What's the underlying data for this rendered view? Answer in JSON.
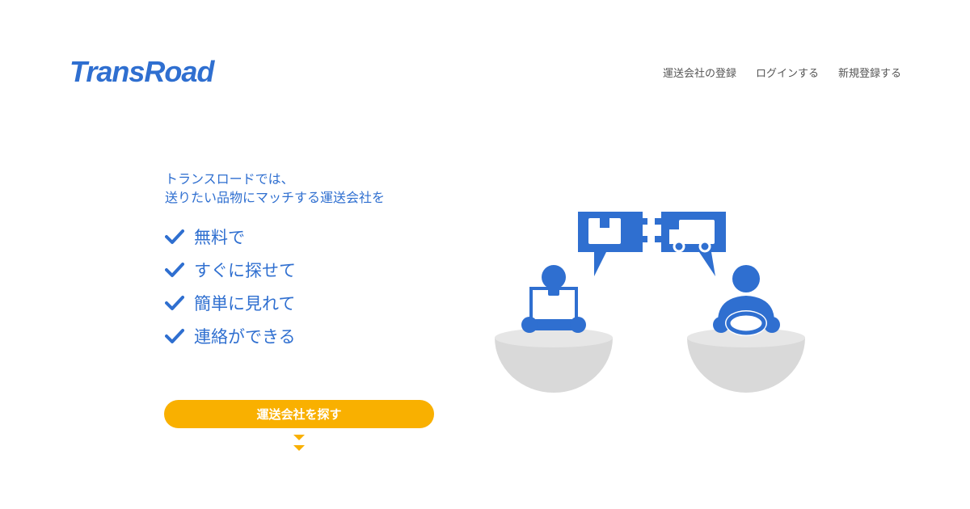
{
  "header": {
    "logo_text": "TransRoad",
    "nav": [
      {
        "label": "運送会社の登録"
      },
      {
        "label": "ログインする"
      },
      {
        "label": "新規登録する"
      }
    ]
  },
  "hero": {
    "intro_line1": "トランスロードでは、",
    "intro_line2": "送りたい品物にマッチする運送会社を",
    "features": [
      {
        "label": "無料で"
      },
      {
        "label": "すぐに探せて"
      },
      {
        "label": "簡単に見れて"
      },
      {
        "label": "連絡ができる"
      }
    ],
    "cta_label": "運送会社を探す"
  },
  "colors": {
    "brand_blue": "#2f6fd0",
    "accent_yellow": "#f9b000",
    "bowl_gray": "#d9d9d9"
  },
  "icons": [
    "check-icon",
    "package-icon",
    "truck-icon",
    "chevron-down-icon"
  ]
}
